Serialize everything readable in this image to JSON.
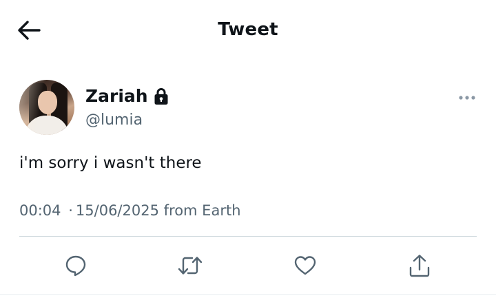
{
  "header": {
    "title": "Tweet",
    "back_icon": "arrow-left-icon"
  },
  "author": {
    "display_name": "Zariah",
    "handle": "@lumia",
    "protected_icon": "lock-icon",
    "more_icon": "more-horizontal-icon"
  },
  "tweet": {
    "text": "i'm sorry i wasn't there",
    "time": "00:04",
    "separator": "·",
    "date": "15/06/2025",
    "source": "from Earth"
  },
  "actions": [
    {
      "name": "reply",
      "icon": "reply-icon"
    },
    {
      "name": "retweet",
      "icon": "retweet-icon"
    },
    {
      "name": "like",
      "icon": "heart-icon"
    },
    {
      "name": "share",
      "icon": "share-icon"
    }
  ],
  "colors": {
    "text": "#0f1419",
    "secondary": "#536471",
    "divider": "#cfd9de"
  }
}
